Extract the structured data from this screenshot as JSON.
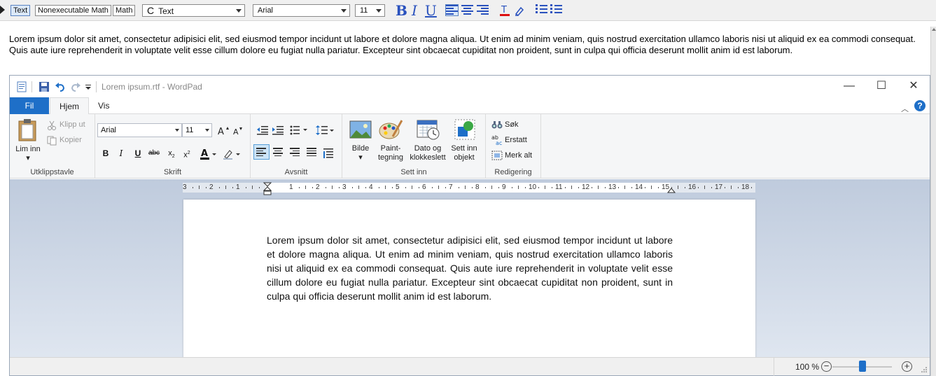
{
  "editor": {
    "mode_buttons": [
      "Text",
      "Nonexecutable Math",
      "Math"
    ],
    "style_select": "Text",
    "style_symbol": "C",
    "font_select": "Arial",
    "size_select": "11",
    "format": {
      "bold": "B",
      "italic": "I",
      "underline": "U"
    },
    "text": "Lorem ipsum dolor sit amet, consectetur adipisici elit, sed eiusmod tempor incidunt ut labore et dolore magna aliqua. Ut enim ad minim veniam, quis nostrud exercitation ullamco laboris nisi ut aliquid ex ea commodi consequat. Quis aute iure reprehenderit in voluptate velit esse cillum dolore eu fugiat nulla pariatur. Excepteur sint obcaecat cupiditat non proident, sunt in culpa qui officia deserunt mollit anim id est laborum."
  },
  "wordpad": {
    "title": "Lorem ipsum.rtf - WordPad",
    "window_buttons": {
      "minimize": "—",
      "maximize": "☐",
      "close": "✕"
    },
    "tabs": {
      "file": "Fil",
      "home": "Hjem",
      "view": "Vis"
    },
    "help": "?",
    "clipboard": {
      "label": "Utklippstavle",
      "paste": "Lim inn",
      "cut": "Klipp ut",
      "copy": "Kopier"
    },
    "font": {
      "label": "Skrift",
      "family": "Arial",
      "size": "11"
    },
    "paragraph": {
      "label": "Avsnitt"
    },
    "insert": {
      "label": "Sett inn",
      "picture": "Bilde",
      "paint": "Paint-tegning",
      "datetime": "Dato og klokkeslett",
      "object": "Sett inn objekt"
    },
    "editing": {
      "label": "Redigering",
      "find": "Søk",
      "replace": "Erstatt",
      "select_all": "Merk alt"
    },
    "ruler_numbers": [
      "3",
      "2",
      "1",
      "1",
      "2",
      "3",
      "4",
      "5",
      "6",
      "7",
      "8",
      "9",
      "10",
      "11",
      "12",
      "13",
      "14",
      "15",
      "16",
      "17",
      "18"
    ],
    "document_text": "Lorem ipsum dolor sit amet, consectetur adipisici elit, sed eiusmod tempor incidunt ut labore et dolore magna aliqua. Ut enim ad minim veniam, quis nostrud exercitation ullamco laboris nisi ut aliquid ex ea commodi consequat. Quis aute iure reprehenderit in voluptate velit esse cillum dolore eu fugiat nulla pariatur. Excepteur sint obcaecat cupiditat non proident, sunt in culpa qui officia deserunt mollit anim id est laborum.",
    "zoom": "100 %",
    "zoom_level": 100
  },
  "colors": {
    "accent": "#1e6fc8",
    "toolbar_blue": "#2a52be"
  }
}
